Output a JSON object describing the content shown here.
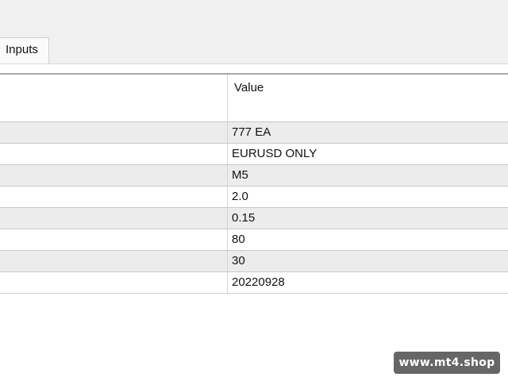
{
  "tabs": {
    "inputs_label": "Inputs"
  },
  "table": {
    "value_header": "Value",
    "rows": [
      {
        "value": "777 EA"
      },
      {
        "value": "EURUSD ONLY"
      },
      {
        "value": "M5"
      },
      {
        "value": "2.0"
      },
      {
        "value": "0.15"
      },
      {
        "value": "80"
      },
      {
        "value": "30"
      },
      {
        "value": "20220928"
      }
    ]
  },
  "watermark": {
    "text": "www.mt4.shop"
  }
}
